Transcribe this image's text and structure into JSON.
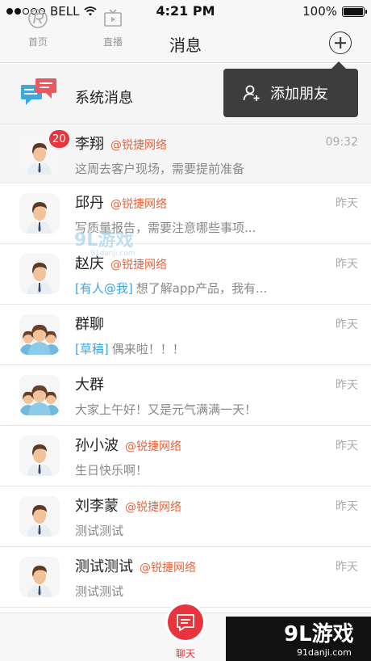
{
  "status_bar": {
    "carrier": "BELL",
    "time": "4:21 PM",
    "battery": "100%"
  },
  "nav": {
    "title": "消息"
  },
  "popup": {
    "label": "添加朋友"
  },
  "system_row": {
    "title": "系统消息"
  },
  "conversations": [
    {
      "name": "李翔",
      "tag": "@锐捷网络",
      "time": "09:32",
      "flag": "",
      "preview": "这周去客户现场，需要提前准备",
      "badge": "20"
    },
    {
      "name": "邱丹",
      "tag": "@锐捷网络",
      "time": "昨天",
      "flag": "",
      "preview": "写质量报告，需要注意哪些事项...",
      "badge": ""
    },
    {
      "name": "赵庆",
      "tag": "@锐捷网络",
      "time": "昨天",
      "flag": "[有人@我]",
      "preview": "想了解app产品，我有...",
      "badge": ""
    },
    {
      "name": "群聊",
      "tag": "",
      "time": "昨天",
      "flag": "[草稿]",
      "preview": "偶来啦！！！",
      "badge": ""
    },
    {
      "name": "大群",
      "tag": "",
      "time": "昨天",
      "flag": "",
      "preview": "大家上午好！又是元气满满一天！",
      "badge": ""
    },
    {
      "name": "孙小波",
      "tag": "@锐捷网络",
      "time": "昨天",
      "flag": "",
      "preview": "生日快乐啊！",
      "badge": ""
    },
    {
      "name": "刘李蒙",
      "tag": "@锐捷网络",
      "time": "昨天",
      "flag": "",
      "preview": "测试测试",
      "badge": ""
    },
    {
      "name": "测试测试",
      "tag": "@锐捷网络",
      "time": "昨天",
      "flag": "",
      "preview": "测试测试",
      "badge": ""
    }
  ],
  "tabs": {
    "home": "首页",
    "live": "直播",
    "chat": "聊天"
  },
  "watermark": {
    "brand": "9L游戏",
    "url": "91danji.com"
  },
  "colors": {
    "accent": "#e8343c",
    "tag": "#e8643c",
    "flag": "#3ea6e0"
  }
}
